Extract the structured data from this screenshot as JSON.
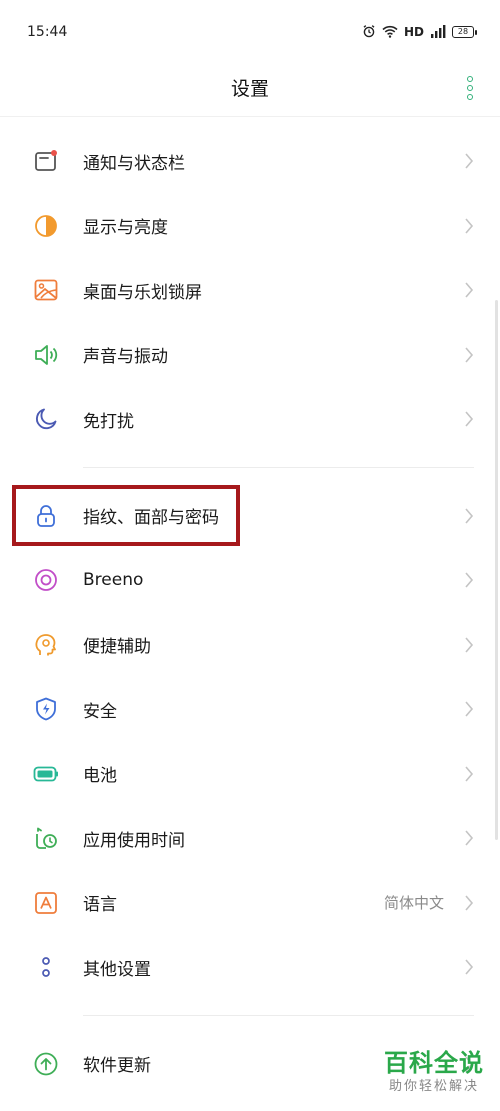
{
  "status_bar": {
    "time": "15:44",
    "network_label": "HD",
    "battery_level": "28"
  },
  "header": {
    "title": "设置",
    "more_icon": "more-vertical-icon",
    "accent_color": "#33b07a"
  },
  "groups": [
    {
      "items": [
        {
          "label": "通知与状态栏",
          "icon": "notification-icon"
        },
        {
          "label": "显示与亮度",
          "icon": "display-brightness-icon"
        },
        {
          "label": "桌面与乐划锁屏",
          "icon": "wallpaper-icon"
        },
        {
          "label": "声音与振动",
          "icon": "speaker-icon"
        },
        {
          "label": "免打扰",
          "icon": "moon-icon"
        }
      ]
    },
    {
      "items": [
        {
          "label": "指纹、面部与密码",
          "icon": "lock-icon"
        },
        {
          "label": "Breeno",
          "icon": "breeno-icon"
        },
        {
          "label": "便捷辅助",
          "icon": "assist-icon"
        },
        {
          "label": "安全",
          "icon": "shield-icon"
        },
        {
          "label": "电池",
          "icon": "battery-icon"
        },
        {
          "label": "应用使用时间",
          "icon": "app-timer-icon"
        },
        {
          "label": "语言",
          "value": "简体中文",
          "icon": "language-icon"
        },
        {
          "label": "其他设置",
          "icon": "other-settings-icon"
        }
      ]
    },
    {
      "items": [
        {
          "label": "软件更新",
          "icon": "update-icon"
        }
      ]
    }
  ],
  "highlight_color": "#a6191c",
  "watermark": {
    "title": "百科全说",
    "subtitle": "助你轻松解决"
  }
}
